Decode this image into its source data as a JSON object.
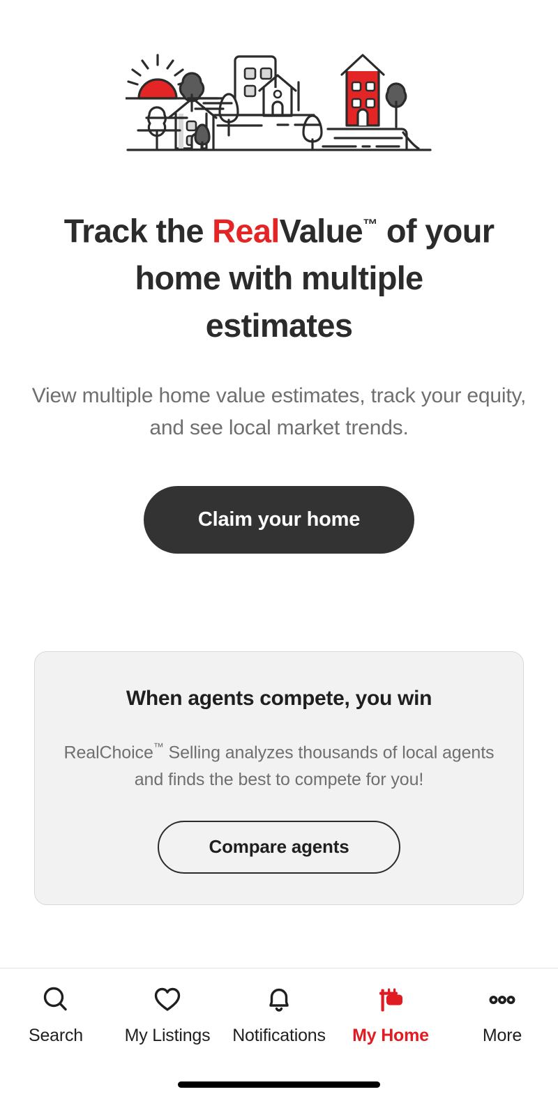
{
  "colors": {
    "brand_red": "#e32526",
    "nav_active_red": "#e11b22",
    "ink": "#2b2b2b",
    "muted": "#6f6f6f",
    "card_bg": "#f2f2f2",
    "card_border": "#d9d9d9",
    "primary_button_bg": "#333333",
    "illustration_outline": "#2b2b2b",
    "illustration_gray": "#5b5b5b",
    "illustration_light": "#e8e8e8"
  },
  "hero": {
    "illustration_name": "neighborhood-skyline-illustration",
    "alt": "Illustration of a neighborhood with houses, trees and a rising sun"
  },
  "headline": {
    "part1": "Track the ",
    "accent": "Real",
    "part2": "Value",
    "trademark": "™",
    "part3": " of your home with multiple estimates",
    "full_text": "Track the RealValue™ of your home with multiple estimates"
  },
  "subtitle": {
    "text": "View multiple home value estimates, track your equity, and see local market trends."
  },
  "primary_cta": {
    "label": "Claim your home"
  },
  "agents_card": {
    "title": "When agents compete, you win",
    "body_part1": "RealChoice",
    "body_trademark": "™",
    "body_part2": " Selling analyzes thousands of local agents and finds the best to compete for you!",
    "body_full": "RealChoice™ Selling analyzes thousands of local agents and finds the best to compete for you!",
    "cta_label": "Compare agents"
  },
  "tabbar": {
    "items": [
      {
        "label": "Search",
        "icon": "search-icon",
        "active": false
      },
      {
        "label": "My Listings",
        "icon": "heart-icon",
        "active": false
      },
      {
        "label": "Notifications",
        "icon": "bell-icon",
        "active": false
      },
      {
        "label": "My Home",
        "icon": "yard-sign-icon",
        "active": true
      },
      {
        "label": "More",
        "icon": "three-dots-icon",
        "active": false
      }
    ]
  }
}
